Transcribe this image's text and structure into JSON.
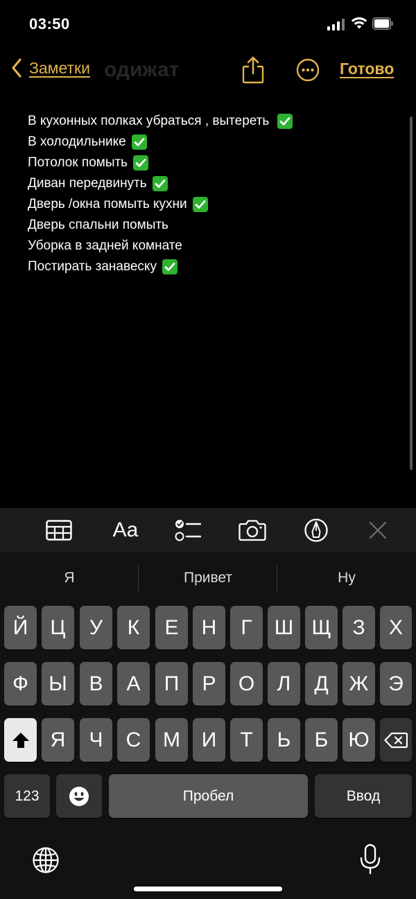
{
  "status_bar": {
    "time": "03:50"
  },
  "nav": {
    "back_label": "Заметки",
    "ghost_title": "одижат",
    "ghost_subtitle": "",
    "done_label": "Готово"
  },
  "note": {
    "lines": [
      {
        "text": "В кухонных полках убраться , вытереть",
        "checked": true
      },
      {
        "text": "В холодильнике",
        "checked": true
      },
      {
        "text": "Потолок помыть",
        "checked": true
      },
      {
        "text": "Диван передвинуть",
        "checked": true
      },
      {
        "text": "Дверь /окна помыть кухни",
        "checked": true
      },
      {
        "text": "Дверь спальни помыть",
        "checked": false
      },
      {
        "text": "Уборка в задней комнате",
        "checked": false
      },
      {
        "text": "Постирать занавеску",
        "checked": true
      }
    ]
  },
  "toolbar": {
    "format_label": "Aa"
  },
  "keyboard": {
    "suggestions": [
      "Я",
      "Привет",
      "Ну"
    ],
    "row1": [
      "Й",
      "Ц",
      "У",
      "К",
      "Е",
      "Н",
      "Г",
      "Ш",
      "Щ",
      "З",
      "Х"
    ],
    "row2": [
      "Ф",
      "Ы",
      "В",
      "А",
      "П",
      "Р",
      "О",
      "Л",
      "Д",
      "Ж",
      "Э"
    ],
    "row3": [
      "Я",
      "Ч",
      "С",
      "М",
      "И",
      "Т",
      "Ь",
      "Б",
      "Ю"
    ],
    "numbers_label": "123",
    "space_label": "Пробел",
    "return_label": "Ввод"
  },
  "colors": {
    "accent": "#e2b24c",
    "check": "#2fb22f",
    "background": "#000000",
    "keyboard": "#121212"
  }
}
